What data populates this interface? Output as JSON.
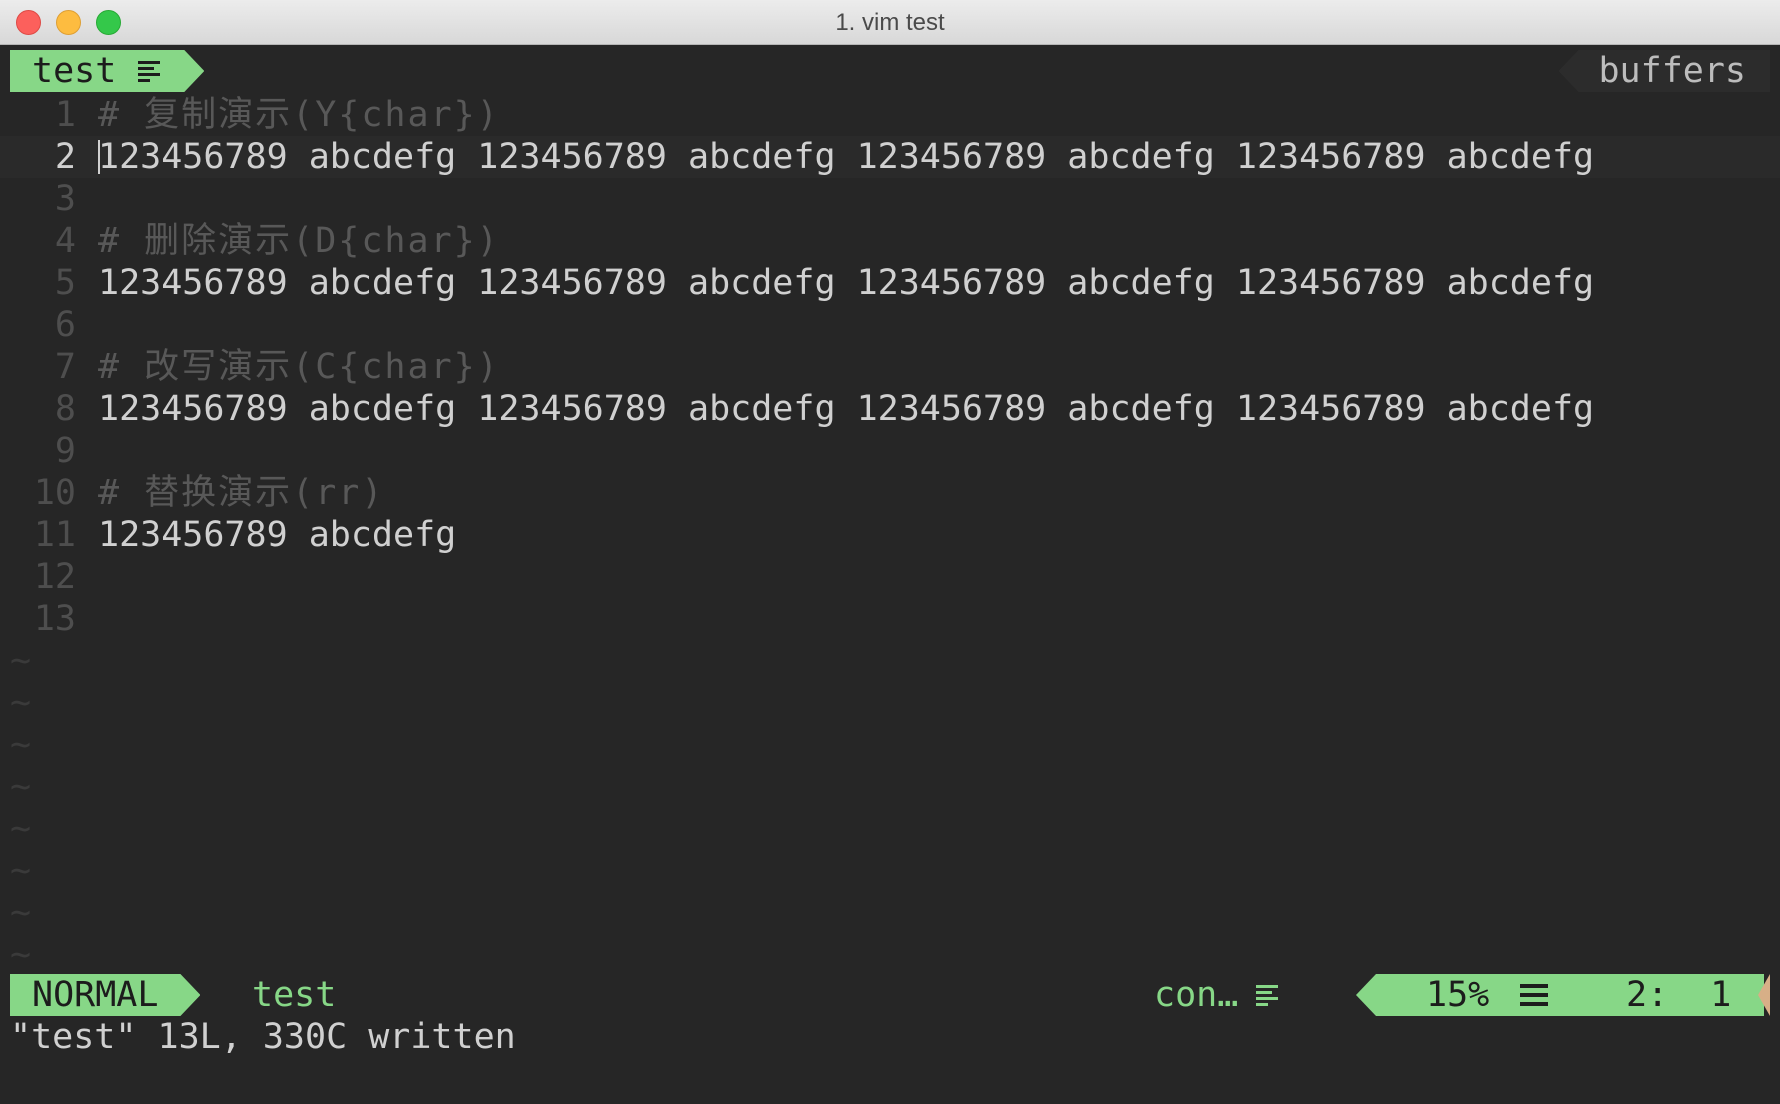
{
  "window": {
    "title": "1. vim test",
    "controls": [
      "close",
      "minimize",
      "zoom"
    ]
  },
  "tabline": {
    "active_tab": "test",
    "active_tab_icon": "filetype-text-icon",
    "right_label": "buffers"
  },
  "buffer": {
    "lines": [
      {
        "number": "1",
        "text": "# 复制演示(Y{char})",
        "kind": "comment"
      },
      {
        "number": "2",
        "text": "123456789 abcdefg 123456789 abcdefg 123456789 abcdefg 123456789 abcdefg",
        "kind": "text",
        "current": true
      },
      {
        "number": "3",
        "text": "",
        "kind": "text"
      },
      {
        "number": "4",
        "text": "# 删除演示(D{char})",
        "kind": "comment"
      },
      {
        "number": "5",
        "text": "123456789 abcdefg 123456789 abcdefg 123456789 abcdefg 123456789 abcdefg",
        "kind": "text"
      },
      {
        "number": "6",
        "text": "",
        "kind": "text"
      },
      {
        "number": "7",
        "text": "# 改写演示(C{char})",
        "kind": "comment"
      },
      {
        "number": "8",
        "text": "123456789 abcdefg 123456789 abcdefg 123456789 abcdefg 123456789 abcdefg",
        "kind": "text"
      },
      {
        "number": "9",
        "text": "",
        "kind": "text"
      },
      {
        "number": "10",
        "text": "# 替换演示(rr)",
        "kind": "comment"
      },
      {
        "number": "11",
        "text": "123456789 abcdefg",
        "kind": "text"
      },
      {
        "number": "12",
        "text": "",
        "kind": "text"
      },
      {
        "number": "13",
        "text": "",
        "kind": "text"
      }
    ],
    "tilde_lines": [
      "~",
      "~",
      "~",
      "~",
      "~",
      "~",
      "~",
      "~"
    ]
  },
  "statusline": {
    "mode": "NORMAL",
    "filename": "test",
    "filetype": "con…",
    "percent": "15%",
    "position": "2:  1"
  },
  "cmdline": {
    "message": "\"test\" 13L, 330C written"
  },
  "colors": {
    "background": "#262626",
    "accent_green": "#87d787",
    "line_number": "#4e4e4e",
    "comment": "#585858",
    "text": "#d0d0d0",
    "warning": "#d7af87"
  }
}
